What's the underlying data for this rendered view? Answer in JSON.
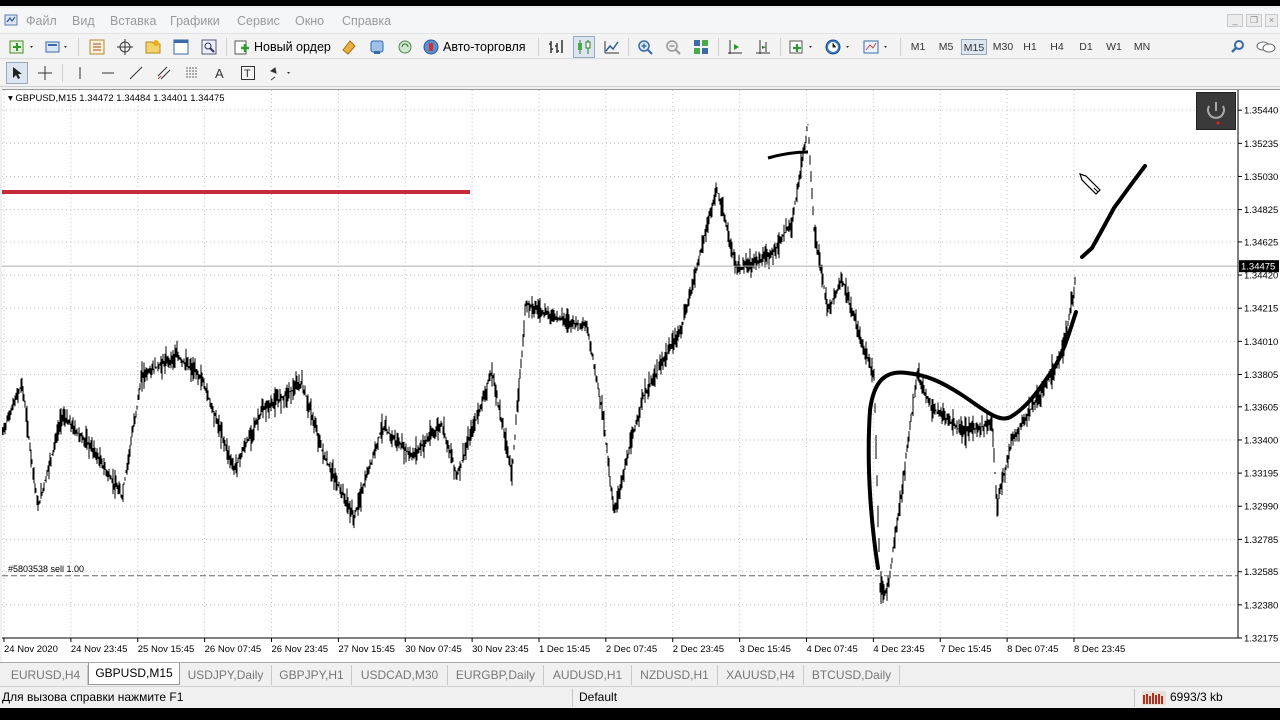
{
  "menu": [
    "Файл",
    "Вид",
    "Вставка",
    "Графики",
    "Сервис",
    "Окно",
    "Справка"
  ],
  "toolbar": {
    "new_order_label": "Новый ордер",
    "autotrading_label": "Авто-торговля",
    "timeframes": [
      "M1",
      "M5",
      "M15",
      "M30",
      "H1",
      "H4",
      "D1",
      "W1",
      "MN"
    ],
    "active_timeframe": "M15"
  },
  "chart": {
    "symbol_info": "GBPUSD,M15  1.34472 1.34484 1.34401 1.34475",
    "current_price": "1.34475",
    "order_label": "#5803538 sell 1.00",
    "price_axis": [
      "1.35440",
      "1.35235",
      "1.35030",
      "1.34825",
      "1.34625",
      "1.34420",
      "1.34215",
      "1.34010",
      "1.33805",
      "1.33605",
      "1.33400",
      "1.33195",
      "1.32990",
      "1.32785",
      "1.32585",
      "1.32380",
      "1.32175"
    ],
    "time_axis": [
      "24 Nov 2020",
      "24 Nov 23:45",
      "25 Nov 15:45",
      "26 Nov 07:45",
      "26 Nov 23:45",
      "27 Nov 15:45",
      "30 Nov 07:45",
      "30 Nov 23:45",
      "1 Dec 15:45",
      "2 Dec 07:45",
      "2 Dec 23:45",
      "3 Dec 15:45",
      "4 Dec 07:45",
      "4 Dec 23:45",
      "7 Dec 15:45",
      "8 Dec 07:45",
      "8 Dec 23:45"
    ],
    "price_min": 1.32175,
    "price_max": 1.3554,
    "colors": {
      "red_line": "#c8283c",
      "drawing": "#000000",
      "grid": "#c0c0c0",
      "price_tag_bg": "#000000"
    }
  },
  "tabs": [
    "EURUSD,H4",
    "GBPUSD,M15",
    "USDJPY,Daily",
    "GBPJPY,H1",
    "USDCAD,M30",
    "EURGBP,Daily",
    "AUDUSD,H1",
    "NZDUSD,H1",
    "XAUUSD,H4",
    "BTCUSD,Daily"
  ],
  "active_tab": "GBPUSD,M15",
  "status": {
    "help": "Для вызова справки нажмите F1",
    "profile": "Default",
    "traffic": "6993/3 kb"
  }
}
